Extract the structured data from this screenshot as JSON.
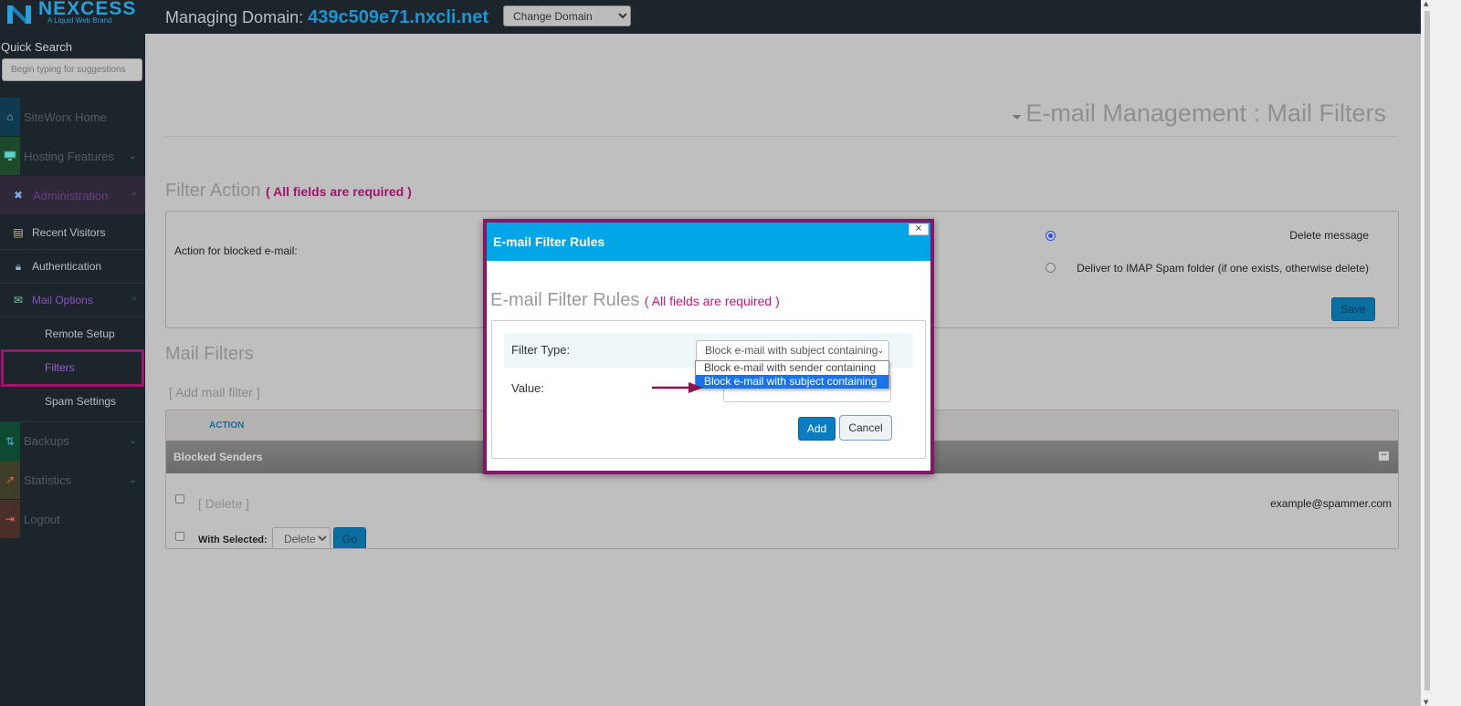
{
  "brand": {
    "name": "NEXCESS",
    "tagline": "A Liquid Web Brand"
  },
  "sidebar": {
    "quick_search_label": "Quick Search",
    "quick_search_placeholder": "Begin typing for suggestions",
    "items": [
      {
        "label": "SiteWorx Home",
        "icon": "home-icon",
        "color": "#0f3a52"
      },
      {
        "label": "Hosting Features",
        "icon": "monitor-icon",
        "color": "#1c4a2a",
        "chevron": "⌄"
      },
      {
        "label": "Administration",
        "icon": "tools-icon",
        "color": "#3a2a4a",
        "chevron": "^",
        "active": true
      },
      {
        "label": "Backups",
        "icon": "backup-arrows-icon",
        "color": "#0e4a30",
        "chevron": "⌄"
      },
      {
        "label": "Statistics",
        "icon": "chart-icon",
        "color": "#3e3e2a",
        "chevron": "⌄"
      },
      {
        "label": "Logout",
        "icon": "logout-icon",
        "color": "#4a2e2a"
      }
    ],
    "admin_subitems": [
      {
        "label": "Recent Visitors",
        "icon": "visitors-icon"
      },
      {
        "label": "Authentication",
        "icon": "lock-icon"
      },
      {
        "label": "Mail Options",
        "icon": "mail-icon",
        "chevron": "^",
        "active": true
      }
    ],
    "mail_subitems": [
      {
        "label": "Remote Setup"
      },
      {
        "label": "Filters",
        "active": true
      },
      {
        "label": "Spam Settings"
      }
    ]
  },
  "topbar": {
    "managing_label": "Managing Domain:",
    "domain": "439c509e71.nxcli.net",
    "change_domain": "Change Domain"
  },
  "page": {
    "title": "E-mail Management : Mail Filters",
    "filter_action_heading": "Filter Action",
    "required_note": "( All fields are required )",
    "action_label": "Action for blocked e-mail:",
    "options": [
      {
        "label": "Delete message",
        "checked": true
      },
      {
        "label": "Deliver to IMAP Spam folder (if one exists, otherwise delete)",
        "checked": false
      }
    ],
    "save_label": "Save",
    "mail_filters_heading": "Mail Filters",
    "add_filter_link": "[ Add mail filter ]",
    "table": {
      "column_action": "ACTION",
      "group_title": "Blocked Senders",
      "collapse_symbol": "−",
      "row_delete_link": "[ Delete ]",
      "row_value": "example@spammer.com",
      "with_selected_label": "With Selected:",
      "with_selected_value": "Delete",
      "go_label": "Go"
    }
  },
  "modal": {
    "title": "E-mail Filter Rules",
    "close_symbol": "×",
    "subtitle": "E-mail Filter Rules",
    "required_note": "( All fields are required )",
    "filter_type_label": "Filter Type:",
    "filter_type_value": "Block e-mail with subject containing",
    "filter_type_options": [
      {
        "label": "Block e-mail with sender containing",
        "selected": false
      },
      {
        "label": "Block e-mail with subject containing",
        "selected": true
      }
    ],
    "value_label": "Value:",
    "value_input": "",
    "add_label": "Add",
    "cancel_label": "Cancel"
  },
  "colors": {
    "accent": "#1f95d0",
    "highlight_border": "#a0146e",
    "modal_header": "#00a5e8",
    "required_text": "#a01470"
  }
}
